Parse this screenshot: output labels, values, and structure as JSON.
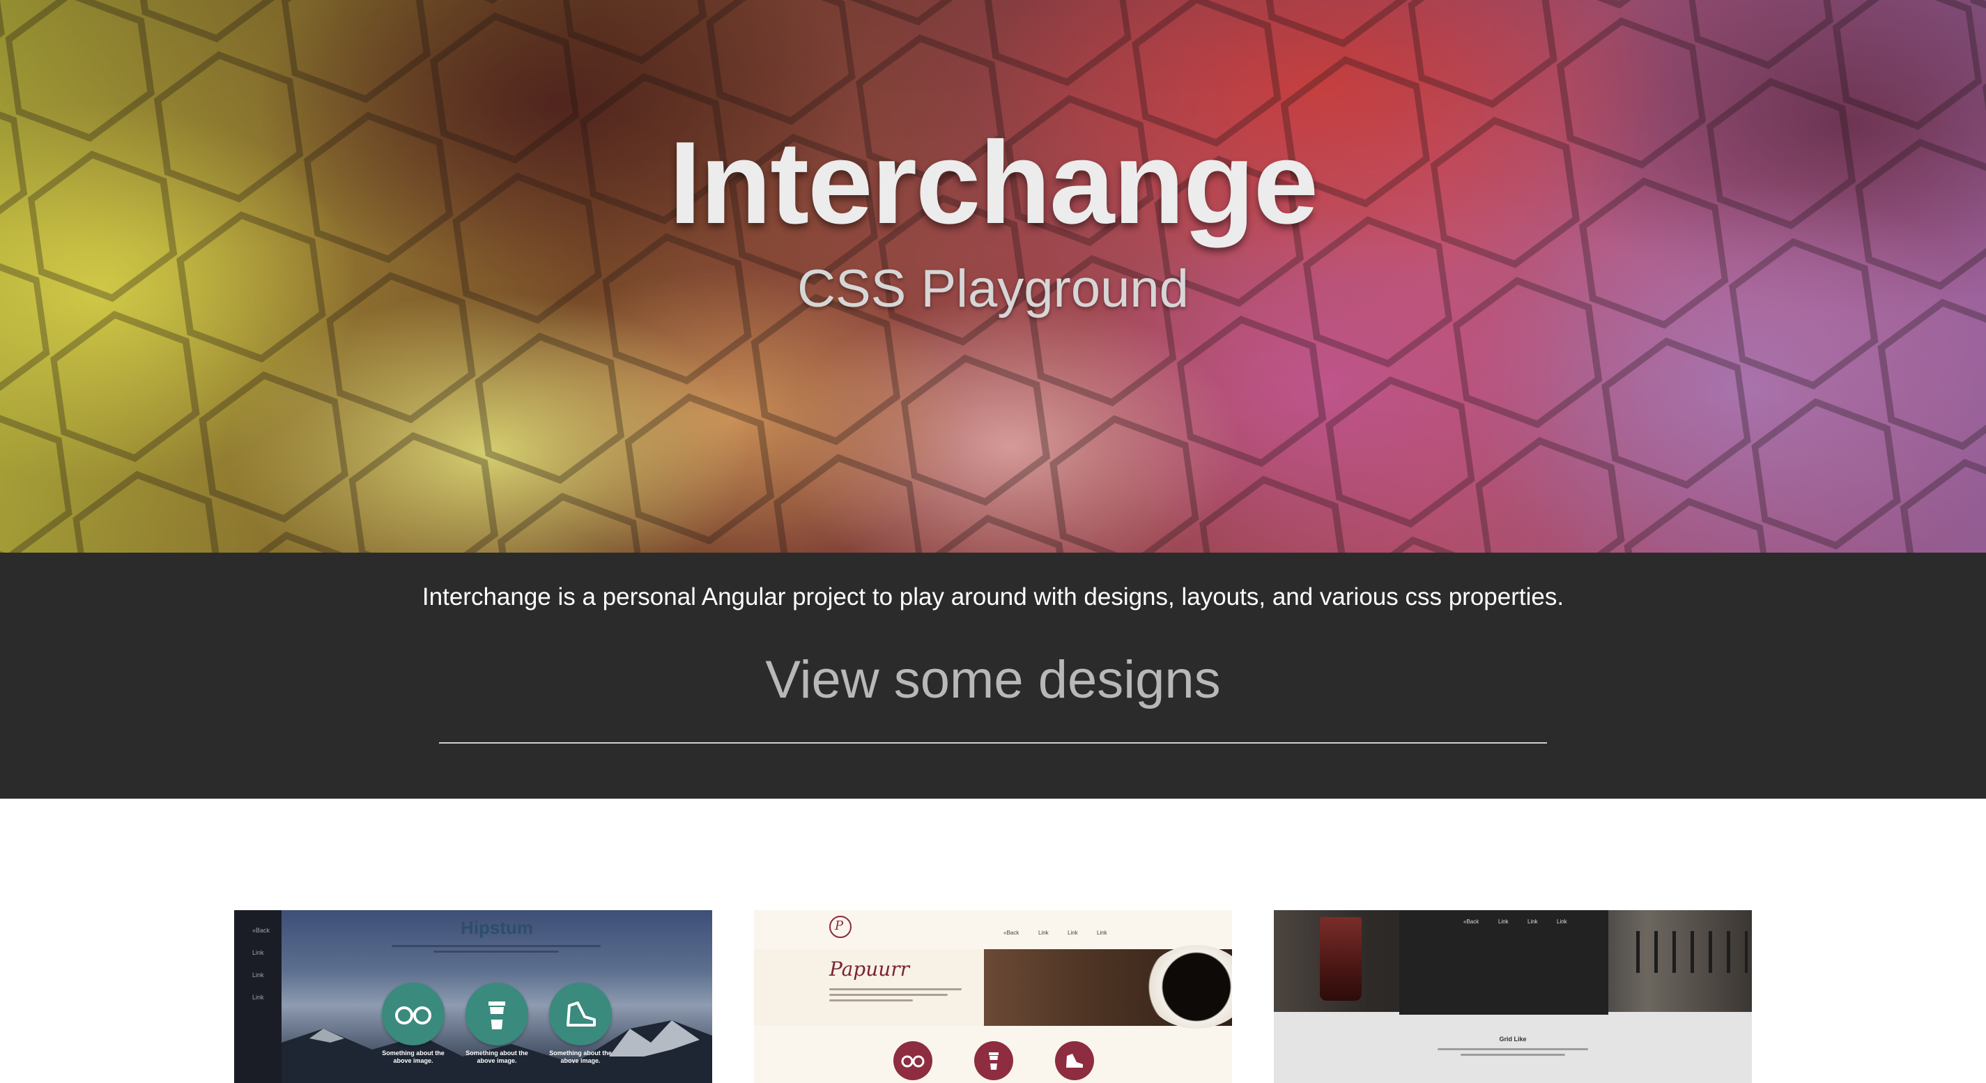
{
  "hero": {
    "title": "Interchange",
    "subtitle": "CSS Playground"
  },
  "intro": {
    "text": "Interchange is a personal Angular project to play around with designs, layouts, and various css properties.",
    "heading": "View some designs"
  },
  "colors": {
    "intro_background": "#2b2b2b",
    "hipstum_accent": "#3a8a7e",
    "papuurr_accent": "#8e2c40"
  },
  "cards": [
    {
      "title": "Hipstum",
      "sidebar_links": [
        "«Back",
        "Link",
        "Link",
        "Link"
      ],
      "captions": [
        "Something about the above image.",
        "Something about the above image.",
        "Something about the above image."
      ],
      "icons": [
        "glasses-icon",
        "coffee-cup-icon",
        "sneaker-icon"
      ]
    },
    {
      "title": "Papuurr",
      "logo": "P",
      "nav": [
        "«Back",
        "Link",
        "Link",
        "Link"
      ],
      "icons": [
        "glasses-icon",
        "coffee-cup-icon",
        "sneaker-icon"
      ]
    },
    {
      "title": "Grid Like",
      "nav": [
        "«Back",
        "Link",
        "Link",
        "Link"
      ]
    }
  ]
}
